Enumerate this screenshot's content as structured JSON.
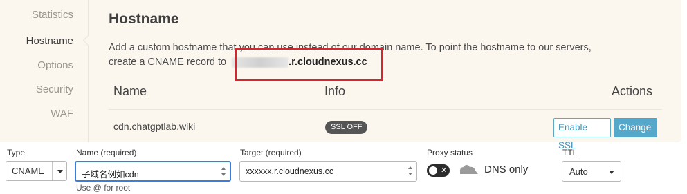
{
  "sidebar": {
    "items": [
      {
        "label": "Statistics"
      },
      {
        "label": "Hostname"
      },
      {
        "label": "Options"
      },
      {
        "label": "Security"
      },
      {
        "label": "WAF"
      }
    ]
  },
  "hostname_section": {
    "title": "Hostname",
    "description_line1": "Add a custom hostname that you can use instead of our domain name. To point the hostname to our servers,",
    "description_line2_prefix": "create a CNAME record to",
    "cname_target_suffix": ".r.cloudnexus.cc",
    "table": {
      "headers": {
        "name": "Name",
        "info": "Info",
        "actions": "Actions"
      },
      "rows": [
        {
          "name": "cdn.chatgptlab.wiki",
          "ssl_badge": "SSL OFF",
          "enable_ssl_label": "Enable SSL",
          "change_label": "Change"
        }
      ]
    }
  },
  "dns_form": {
    "type_label": "Type",
    "type_value": "CNAME",
    "name_label": "Name (required)",
    "name_value": "子域名例如cdn",
    "name_hint": "Use @ for root",
    "target_label": "Target (required)",
    "target_value": "xxxxxx.r.cloudnexus.cc",
    "proxy_label": "Proxy status",
    "proxy_state_text": "DNS only",
    "proxy_enabled": false,
    "ttl_label": "TTL",
    "ttl_value": "Auto"
  },
  "colors": {
    "panel_bg": "#fbf6ee",
    "highlight_border": "#d9232d",
    "button_blue": "#56a8cb",
    "focus_blue": "#3b7ddd",
    "cloud_gray": "#9a9a9a"
  },
  "icons": [
    "toggle-switch-icon",
    "cloud-icon",
    "chevron-down-icon",
    "spinner-up-icon",
    "spinner-down-icon"
  ]
}
